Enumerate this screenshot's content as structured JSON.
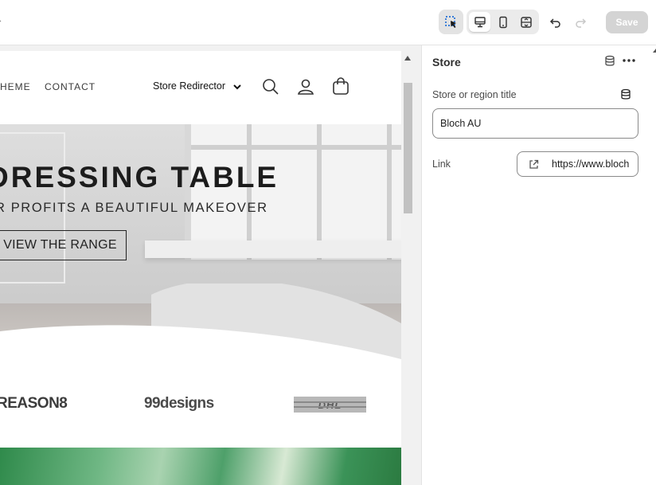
{
  "toolbar": {
    "icons": [
      "select-tool-icon",
      "desktop-view-icon",
      "mobile-view-icon",
      "fullscreen-icon",
      "undo-icon",
      "redo-icon"
    ],
    "save_label": "Save"
  },
  "preview": {
    "nav": {
      "theme": "HEME",
      "contact": "CONTACT",
      "store_redirector": "Store Redirector"
    },
    "hero": {
      "title": "DRESSING TABLE",
      "subtitle": "R PROFITS A BEAUTIFUL MAKEOVER",
      "button": "VIEW THE RANGE"
    },
    "logos": {
      "reason8": "REASON8",
      "designs": "99designs",
      "dhl": "DHL"
    }
  },
  "panel": {
    "title": "Store",
    "store_title_label": "Store or region title",
    "store_title_value": "Bloch AU",
    "link_label": "Link",
    "link_value": "https://www.bloch"
  },
  "colors": {
    "save_disabled": "#d4d4d4",
    "select_active": "#005bd3"
  }
}
